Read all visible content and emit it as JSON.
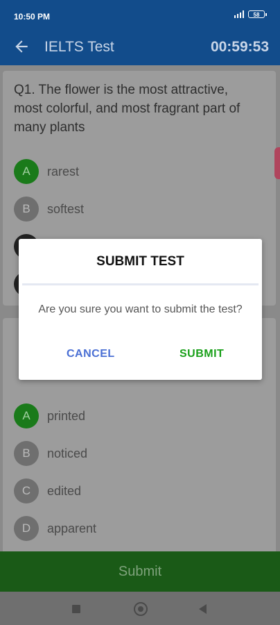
{
  "status": {
    "time": "10:50 PM",
    "battery": "58"
  },
  "app_bar": {
    "title": "IELTS Test",
    "timer": "00:59:53"
  },
  "questions": [
    {
      "text": "Q1. The flower is the most attractive, most colorful, and most fragrant part of many plants",
      "options": [
        {
          "letter": "A",
          "text": "rarest"
        },
        {
          "letter": "B",
          "text": "softest"
        }
      ]
    },
    {
      "options": [
        {
          "letter": "A",
          "text": "printed"
        },
        {
          "letter": "B",
          "text": "noticed"
        },
        {
          "letter": "C",
          "text": "edited"
        },
        {
          "letter": "D",
          "text": "apparent"
        }
      ]
    }
  ],
  "bottom": {
    "submit_label": "Submit"
  },
  "dialog": {
    "title": "SUBMIT TEST",
    "message": "Are you sure you want to submit the test?",
    "cancel_label": "CANCEL",
    "submit_label": "SUBMIT"
  },
  "colors": {
    "primary": "#124c8b",
    "accent_green": "#1aa01a",
    "cancel_blue": "#4a6fd4"
  }
}
